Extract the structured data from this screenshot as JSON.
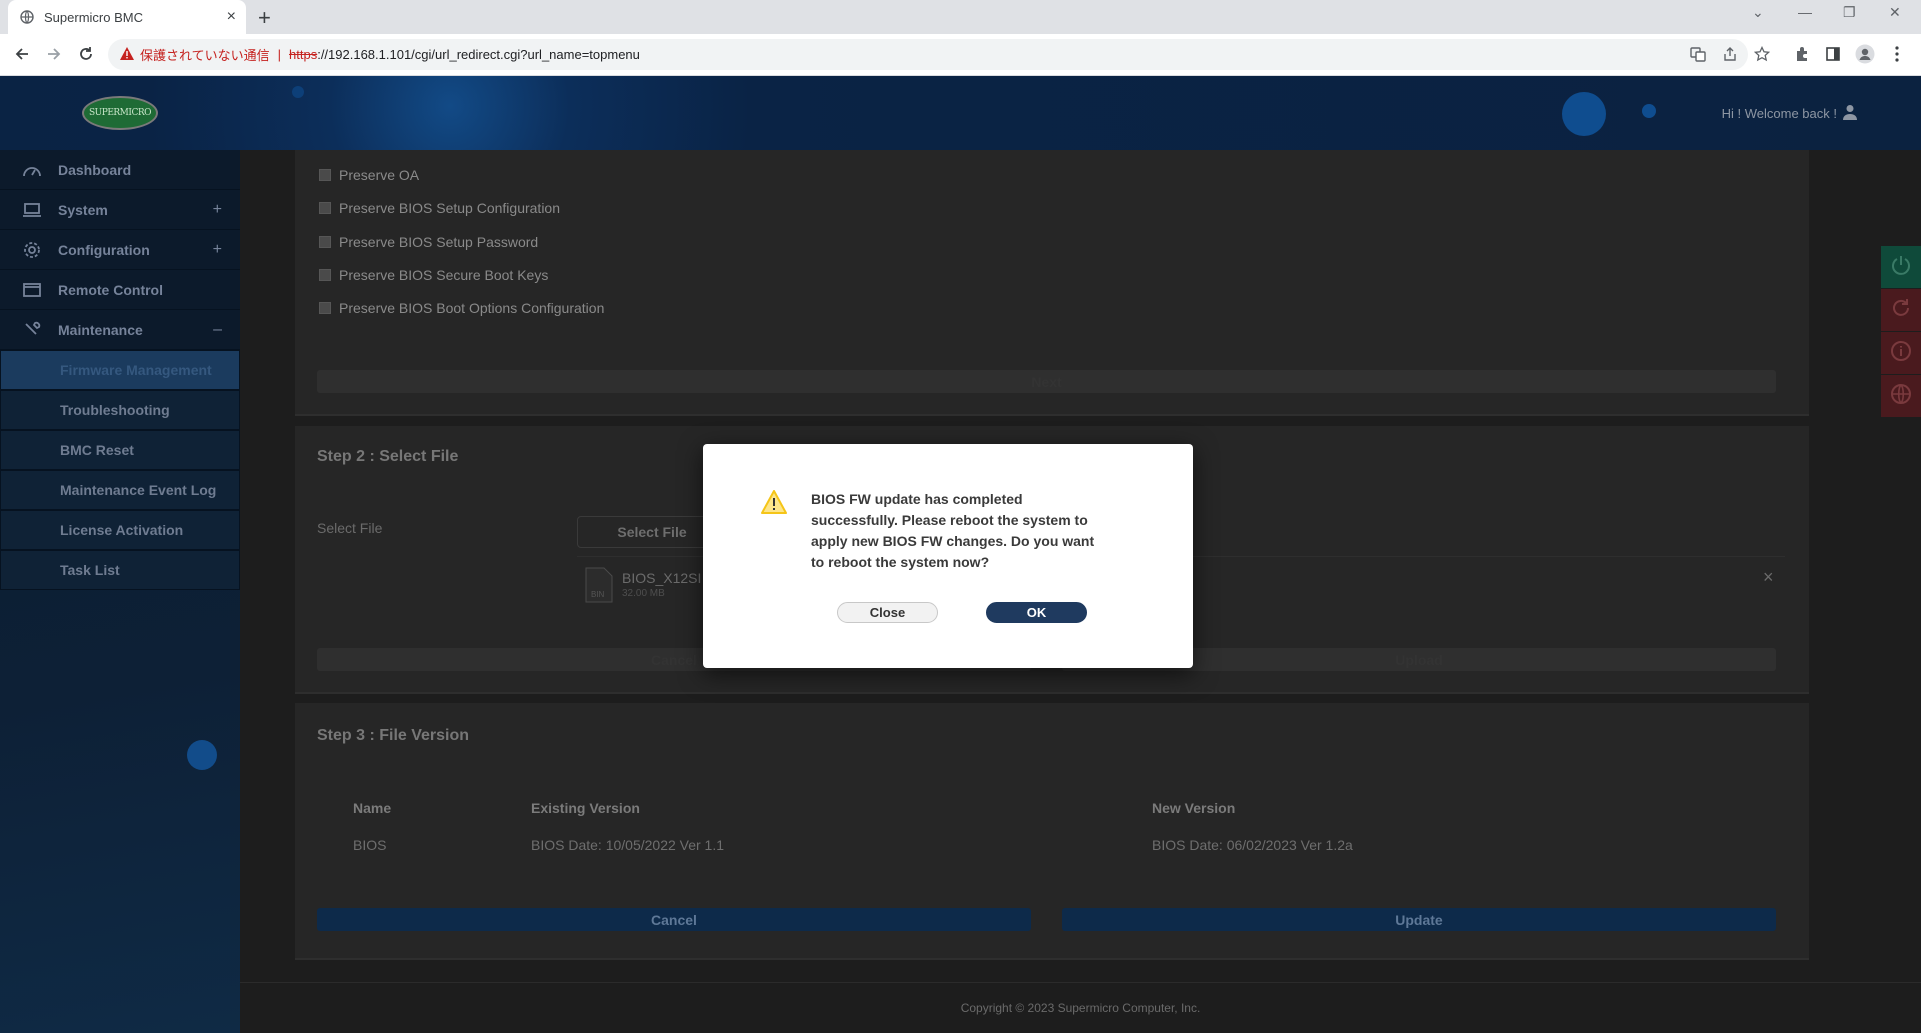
{
  "browser": {
    "tab_title": "Supermicro BMC",
    "tab_close": "×",
    "new_tab": "+",
    "security_warning": "保護されていない通信",
    "url_scheme": "https",
    "url_rest": "://192.168.1.101/cgi/url_redirect.cgi?url_name=topmenu"
  },
  "header": {
    "logo_text": "SUPERMICRO",
    "welcome": "Hi ! Welcome back !"
  },
  "sidebar": {
    "items": [
      {
        "label": "Dashboard",
        "toggle": ""
      },
      {
        "label": "System",
        "toggle": "+"
      },
      {
        "label": "Configuration",
        "toggle": "+"
      },
      {
        "label": "Remote Control",
        "toggle": ""
      },
      {
        "label": "Maintenance",
        "toggle": "–"
      }
    ],
    "subitems": [
      {
        "label": "Firmware Management"
      },
      {
        "label": "Troubleshooting"
      },
      {
        "label": "BMC Reset"
      },
      {
        "label": "Maintenance Event Log"
      },
      {
        "label": "License Activation"
      },
      {
        "label": "Task List"
      }
    ]
  },
  "step1": {
    "options": [
      "Preserve OA",
      "Preserve BIOS Setup Configuration",
      "Preserve BIOS Setup Password",
      "Preserve BIOS Secure Boot Keys",
      "Preserve BIOS Boot Options Configuration"
    ],
    "next_label": "Next"
  },
  "step2": {
    "title": "Step 2 : Select File",
    "select_file_label": "Select File",
    "select_file_button": "Select File",
    "file_name": "BIOS_X12SI",
    "file_size": "32.00 MB",
    "file_icon_text": "BIN",
    "remove": "×",
    "cancel_label": "Cancel",
    "upload_label": "Upload"
  },
  "step3": {
    "title": "Step 3 : File Version",
    "headers": {
      "name": "Name",
      "existing": "Existing Version",
      "new": "New Version"
    },
    "row": {
      "name": "BIOS",
      "existing": "BIOS Date: 10/05/2022 Ver 1.1",
      "new": "BIOS Date: 06/02/2023 Ver 1.2a"
    },
    "cancel_label": "Cancel",
    "update_label": "Update"
  },
  "footer": {
    "copyright": "Copyright © 2023 Supermicro Computer, Inc."
  },
  "dialog": {
    "message": "BIOS FW update has completed successfully. Please reboot the system to apply new BIOS FW changes. Do you want to reboot the system now?",
    "close_label": "Close",
    "ok_label": "OK"
  },
  "colors": {
    "accent": "#1f3a5f",
    "warning": "#f5c518",
    "danger": "#c5221f"
  },
  "icons": [
    "globe-icon",
    "warning-icon",
    "back-icon",
    "forward-icon",
    "reload-icon",
    "translate-icon",
    "share-icon",
    "star-icon",
    "extension-icon",
    "sidepanel-icon",
    "profile-icon",
    "menu-icon",
    "dashboard-icon",
    "monitor-icon",
    "gear-icon",
    "remote-icon",
    "wrench-icon",
    "power-icon",
    "refresh-icon",
    "info-icon",
    "language-icon",
    "user-icon",
    "file-icon"
  ]
}
